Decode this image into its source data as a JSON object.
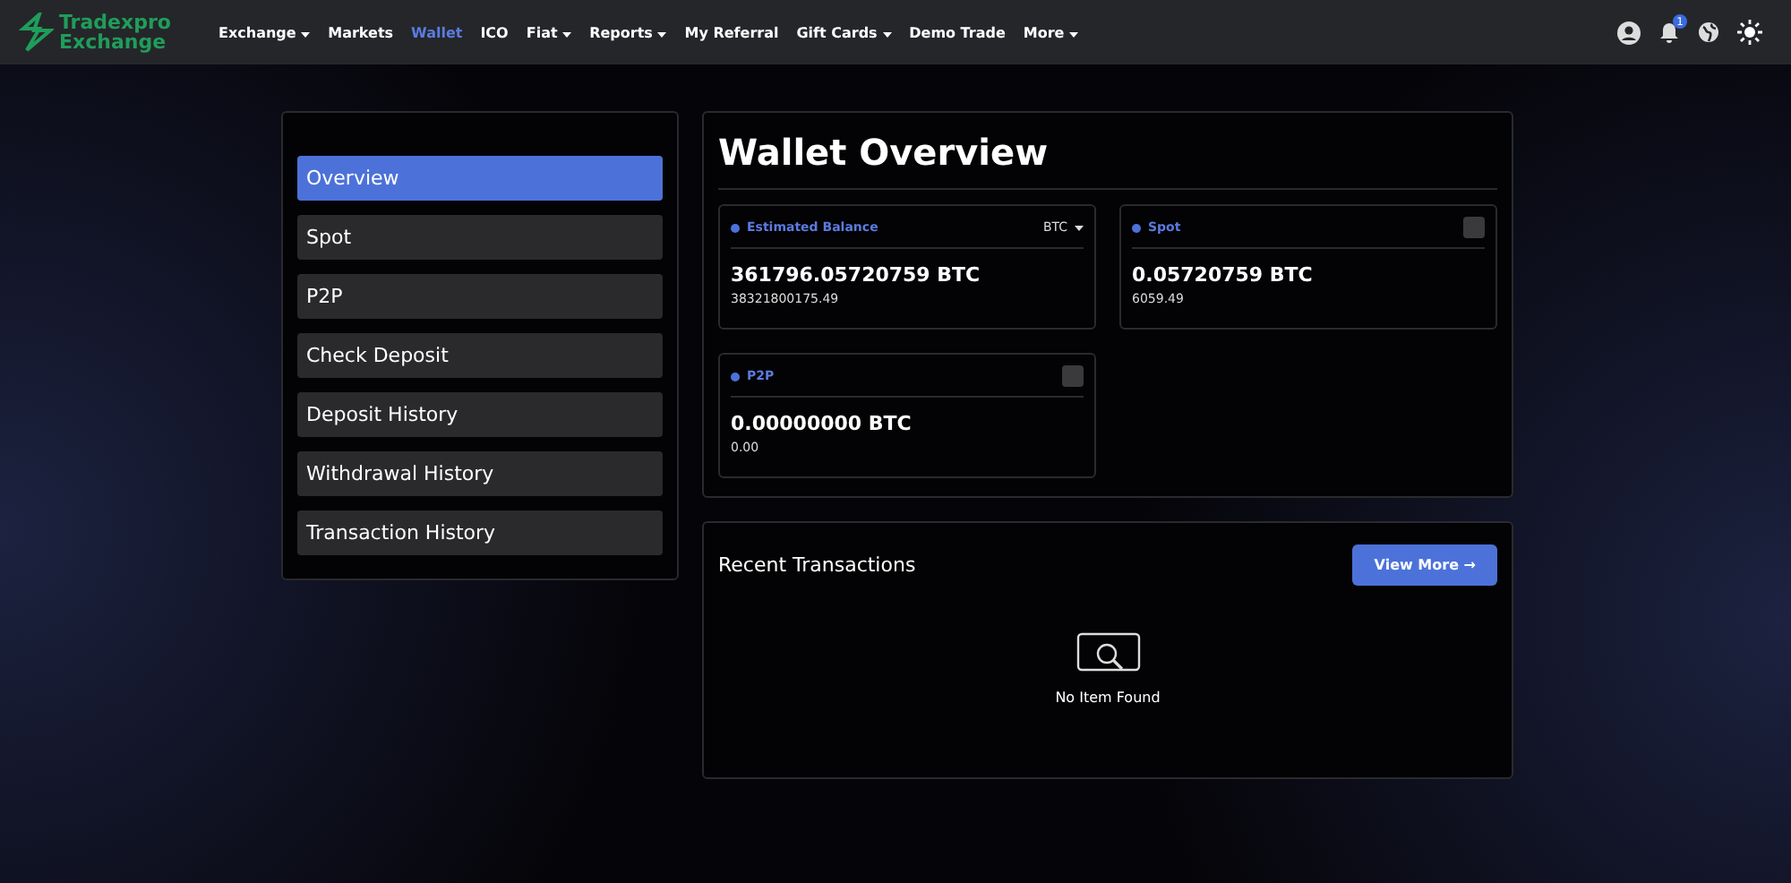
{
  "brand": {
    "line_1": "Tradexpro",
    "line_2": "Exchange"
  },
  "nav": [
    {
      "label": "Exchange",
      "dropdown": true,
      "selected": false
    },
    {
      "label": "Markets",
      "dropdown": false,
      "selected": false
    },
    {
      "label": "Wallet",
      "dropdown": false,
      "selected": true
    },
    {
      "label": "ICO",
      "dropdown": false,
      "selected": false
    },
    {
      "label": "Fiat",
      "dropdown": true,
      "selected": false
    },
    {
      "label": "Reports",
      "dropdown": true,
      "selected": false
    },
    {
      "label": "My Referral",
      "dropdown": false,
      "selected": false
    },
    {
      "label": "Gift Cards",
      "dropdown": true,
      "selected": false
    },
    {
      "label": "Demo Trade",
      "dropdown": false,
      "selected": false
    },
    {
      "label": "More",
      "dropdown": true,
      "selected": false
    }
  ],
  "notification_count": "1",
  "sidebar": {
    "items": [
      {
        "label": "Overview",
        "selected": true
      },
      {
        "label": "Spot",
        "selected": false
      },
      {
        "label": "P2P",
        "selected": false
      },
      {
        "label": "Check Deposit",
        "selected": false
      },
      {
        "label": "Deposit History",
        "selected": false
      },
      {
        "label": "Withdrawal History",
        "selected": false
      },
      {
        "label": "Transaction History",
        "selected": false
      }
    ]
  },
  "overview": {
    "title": "Wallet Overview",
    "cards": [
      {
        "kind": "currency",
        "label": "Estimated Balance",
        "currency": "BTC",
        "amount": "361796.05720759 BTC",
        "value": "38321800175.49"
      },
      {
        "kind": "toggle",
        "label": "Spot",
        "amount": "0.05720759 BTC",
        "value": "6059.49"
      },
      {
        "kind": "toggle",
        "label": "P2P",
        "amount": "0.00000000 BTC",
        "value": "0.00"
      }
    ]
  },
  "recent": {
    "title": "Recent Transactions",
    "button": "View More →",
    "empty": "No Item Found"
  }
}
